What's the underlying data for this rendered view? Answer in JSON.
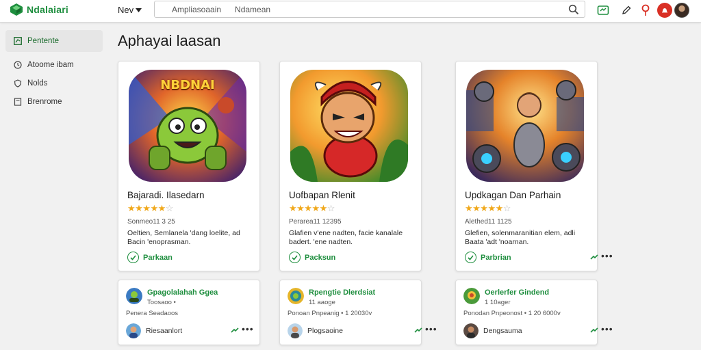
{
  "brand": {
    "name": "Ndalaiari",
    "color": "#1e8e3e"
  },
  "header": {
    "nav_label": "Nev",
    "search_chip": "Ampliasoaain",
    "search_placeholder": "Ndamean",
    "icons": [
      "gamepad-icon",
      "edit-icon",
      "location-pin-icon",
      "notification-icon",
      "avatar"
    ]
  },
  "sidebar": {
    "items": [
      {
        "label": "Pentente",
        "icon": "apps-icon",
        "active": true
      },
      {
        "label": "Atoome ibam",
        "icon": "clock-icon",
        "active": false
      },
      {
        "label": "Nolds",
        "icon": "shield-icon",
        "active": false
      },
      {
        "label": "Brenrome",
        "icon": "bookmark-icon",
        "active": false
      }
    ]
  },
  "main": {
    "title": "Aphayai laasan",
    "apps": [
      {
        "name": "Bajaradi. Ilasedarn",
        "art_label": "NBDNAI",
        "rating": 4.5,
        "meta": "Sonmeo11 3 25",
        "desc": "Oeltien, Semlanela 'dang loelite, ad Bacin 'enoprasman.",
        "install_label": "Parkaan"
      },
      {
        "name": "Uofbapan Rlenit",
        "rating": 4.5,
        "meta": "Perarea11 12395",
        "desc": "Glafien v'ene nadten, facie kanalale badert. 'ene nadten.",
        "install_label": "Packsun"
      },
      {
        "name": "Updkagan Dan Parhain",
        "rating": 4.5,
        "meta": "Alethed11 1125",
        "desc": "Glefien, solenmaranitian elem, adli Baata 'adt 'noarnan.",
        "install_label": "Parbrian"
      }
    ],
    "developers": [
      {
        "name": "Gpagolalahah Ggea",
        "sub": "Toosaoo •",
        "line": "Penera Seadaoos",
        "user": "Riesaanlort"
      },
      {
        "name": "Rpengtie Dlerdsiat",
        "sub": "11 aaoge",
        "line": "Ponoan Pnpeanig • 1 20030v",
        "user": "Plogsaoine"
      },
      {
        "name": "Oerlerfer Gindend",
        "sub": "1 10ager",
        "line": "Ponodan Pnpeonost • 1 20 6000v",
        "user": "Dengsauma"
      }
    ]
  }
}
